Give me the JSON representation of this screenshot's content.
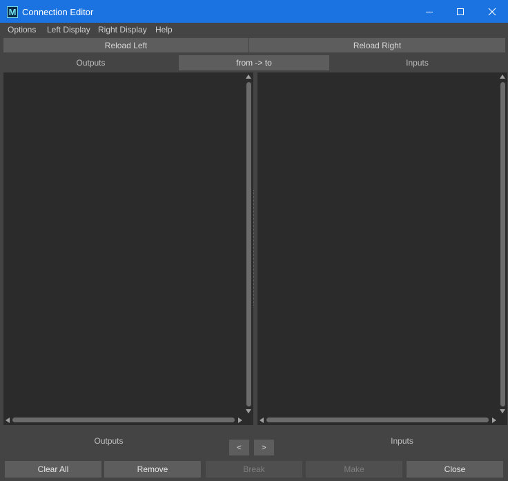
{
  "window": {
    "title": "Connection Editor",
    "app_icon_letter": "M",
    "titlebar_color": "#1a73e0"
  },
  "menubar": {
    "items": [
      {
        "label": "Options"
      },
      {
        "label": "Left Display"
      },
      {
        "label": "Right Display"
      },
      {
        "label": "Help"
      }
    ]
  },
  "toolbar": {
    "reload_left": "Reload Left",
    "reload_right": "Reload Right"
  },
  "headers": {
    "outputs": "Outputs",
    "direction": "from -> to",
    "inputs": "Inputs"
  },
  "lists": {
    "left_items": [],
    "right_items": []
  },
  "footer": {
    "outputs_label": "Outputs",
    "inputs_label": "Inputs",
    "prev_label": "<",
    "next_label": ">"
  },
  "actions": {
    "clear_all": "Clear All",
    "remove": "Remove",
    "break": "Break",
    "make": "Make",
    "close": "Close"
  },
  "icons": {
    "minimize": "minimize-icon",
    "maximize": "maximize-icon",
    "close": "close-icon"
  },
  "colors": {
    "background": "#444444",
    "panel": "#2b2b2b",
    "button": "#5d5d5d"
  }
}
